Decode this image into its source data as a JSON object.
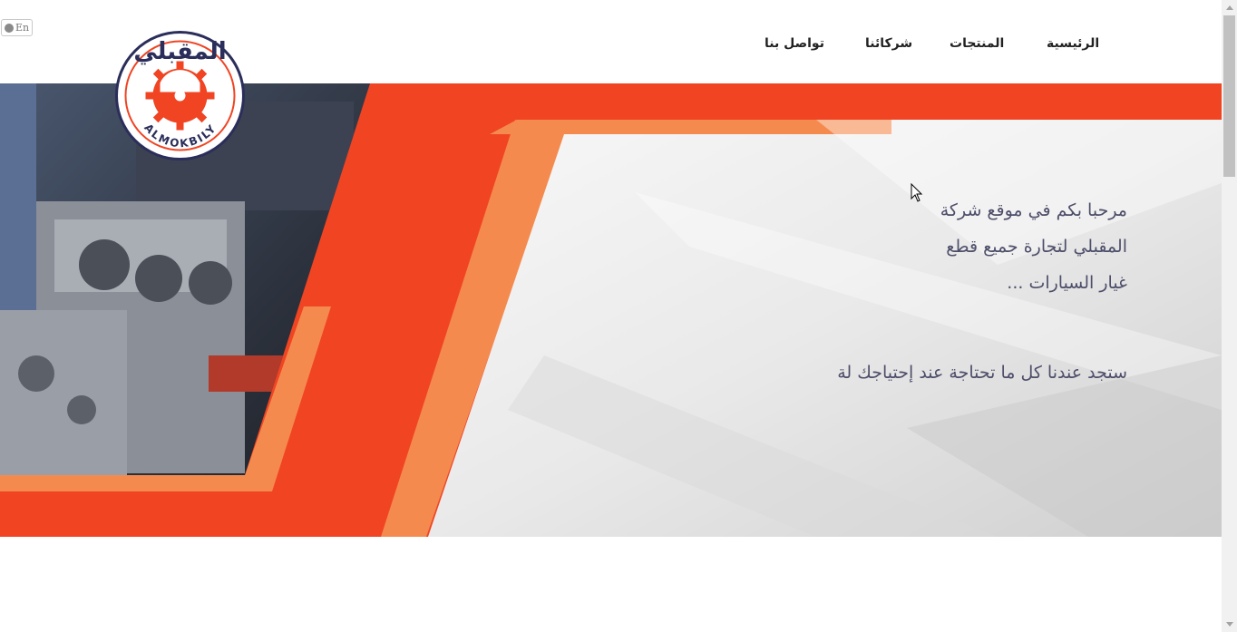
{
  "lang_toggle": {
    "label": "En"
  },
  "nav": {
    "items": [
      {
        "label": "الرئيسية"
      },
      {
        "label": "المنتجات"
      },
      {
        "label": "شركائنا"
      },
      {
        "label": "تواصل بنا"
      }
    ]
  },
  "logo": {
    "arabic_text": "المقبلي",
    "latin_text": "ALMOKBILY",
    "icon": "gear-logo-icon"
  },
  "hero": {
    "welcome_line1": "مرحبا بكم في موقع شركة",
    "welcome_line2": "المقبلي لتجارة جميع قطع",
    "welcome_line3": "غيار السيارات ...",
    "tagline": "ستجد عندنا كل ما تحتاجة عند إحتياجك لة",
    "image_icon": "engine-photo-icon"
  },
  "colors": {
    "accent": "#f04423",
    "accent_light": "#f58a4e",
    "navy": "#2b2e5a",
    "text": "#4d4e6a"
  }
}
